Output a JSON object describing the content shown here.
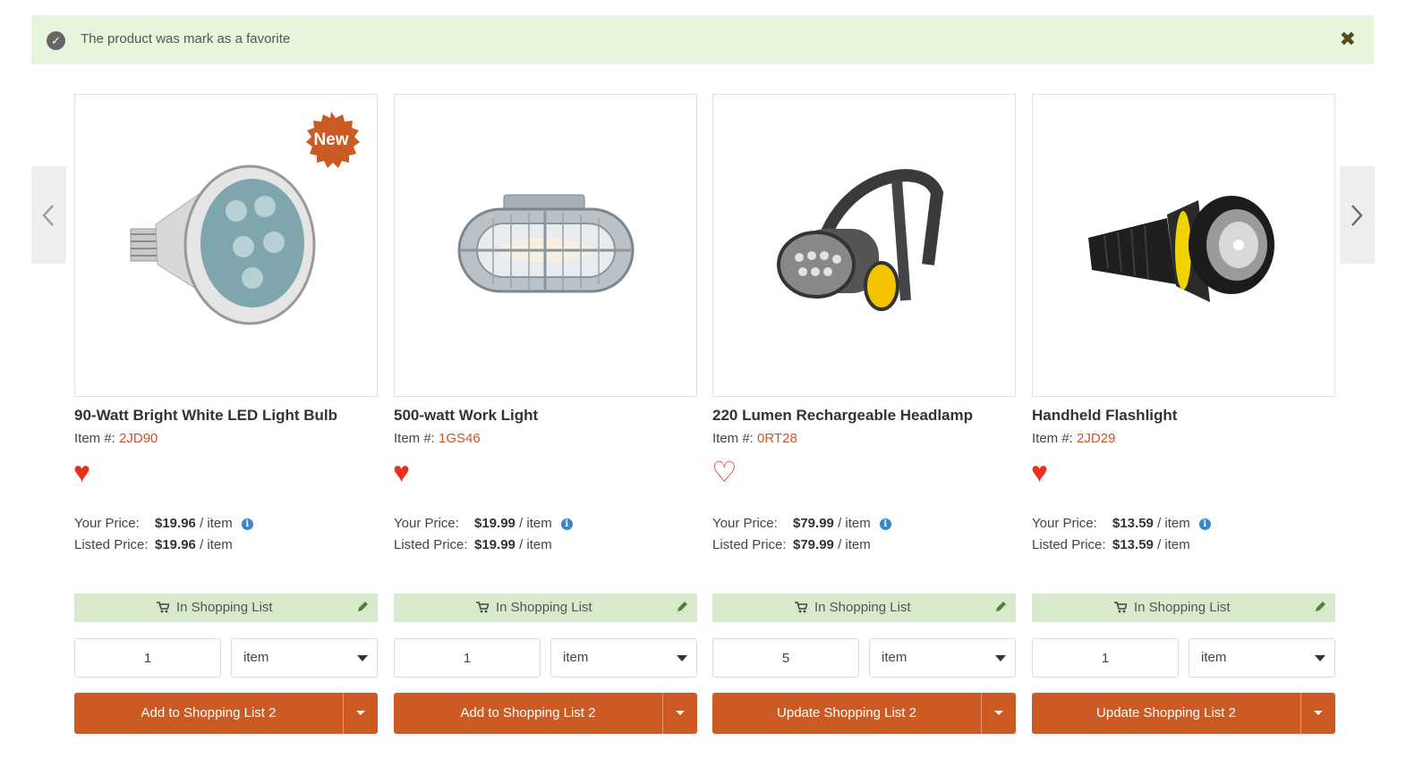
{
  "notice": {
    "message": "The product was mark as a favorite"
  },
  "price_labels": {
    "your": "Your Price:",
    "listed": "Listed Price:",
    "per": "/ item"
  },
  "item_label": "Item #:",
  "in_list_label": "In Shopping List",
  "products": [
    {
      "title": "90-Watt Bright White LED Light Bulb",
      "code": "2JD90",
      "favorite": true,
      "badge": "New",
      "your_price": "$19.96",
      "listed_price": "$19.96",
      "qty": "1",
      "unit": "item",
      "action": "Add to Shopping List 2"
    },
    {
      "title": "500-watt Work Light",
      "code": "1GS46",
      "favorite": true,
      "badge": "",
      "your_price": "$19.99",
      "listed_price": "$19.99",
      "qty": "1",
      "unit": "item",
      "action": "Add to Shopping List 2"
    },
    {
      "title": "220 Lumen Rechargeable Headlamp",
      "code": "0RT28",
      "favorite": false,
      "badge": "",
      "your_price": "$79.99",
      "listed_price": "$79.99",
      "qty": "5",
      "unit": "item",
      "action": "Update Shopping List 2"
    },
    {
      "title": "Handheld Flashlight",
      "code": "2JD29",
      "favorite": true,
      "badge": "",
      "your_price": "$13.59",
      "listed_price": "$13.59",
      "qty": "1",
      "unit": "item",
      "action": "Update Shopping List 2"
    }
  ],
  "colors": {
    "accent": "#cc5a24",
    "success_bg": "#e6f5dc",
    "in_list_bg": "#d7ebcc",
    "heart": "#e8301f",
    "code": "#c8522a",
    "info": "#3a86c8"
  },
  "icons": {
    "notice": "check-circle-icon",
    "close": "close-icon",
    "prev": "chevron-left-icon",
    "next": "chevron-right-icon",
    "favorite": "heart-icon",
    "info": "info-icon",
    "cart": "cart-icon",
    "edit": "pencil-icon",
    "dropdown": "caret-down-icon"
  }
}
